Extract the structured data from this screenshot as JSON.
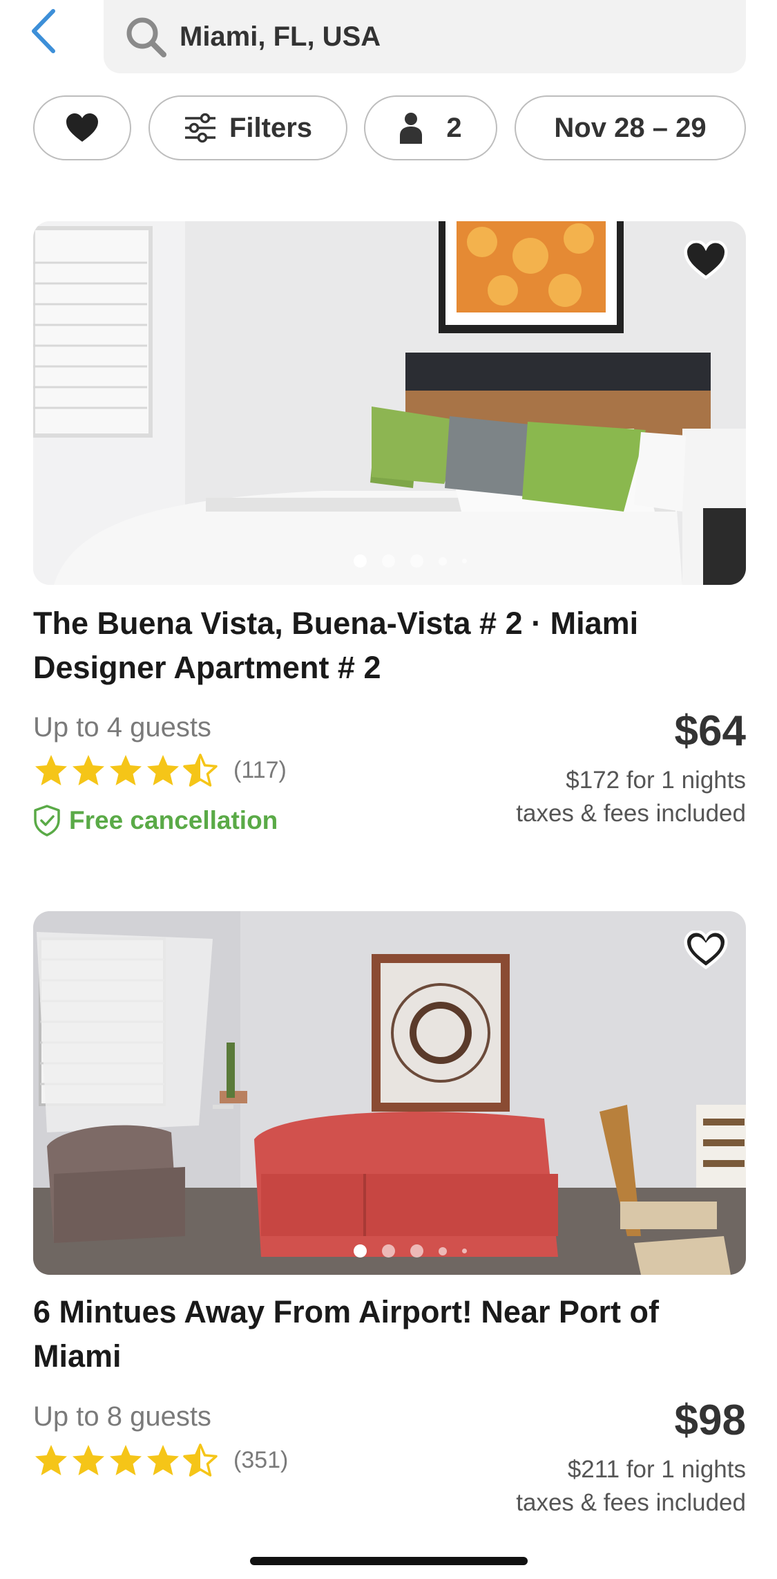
{
  "search": {
    "query": "Miami, FL, USA"
  },
  "chips": {
    "filters_label": "Filters",
    "guests_count": "2",
    "dates": "Nov 28 – 29"
  },
  "listings": [
    {
      "title": "The Buena Vista, Buena-Vista # 2 · Miami Designer Apartment # 2",
      "guests": "Up to 4 guests",
      "rating": 4.5,
      "reviews": "(117)",
      "free_cancellation": "Free cancellation",
      "price": "$64",
      "total": "$172 for 1 nights",
      "fees": "taxes & fees included"
    },
    {
      "title": "6 Mintues Away From Airport! Near Port of Miami",
      "guests": "Up to 8 guests",
      "rating": 4.5,
      "reviews": "(351)",
      "price": "$98",
      "total": "$211 for 1 nights",
      "fees": "taxes & fees included"
    }
  ],
  "colors": {
    "accent": "#3d8fd8",
    "star": "#f5c518",
    "free_cancel": "#5aaa47"
  }
}
